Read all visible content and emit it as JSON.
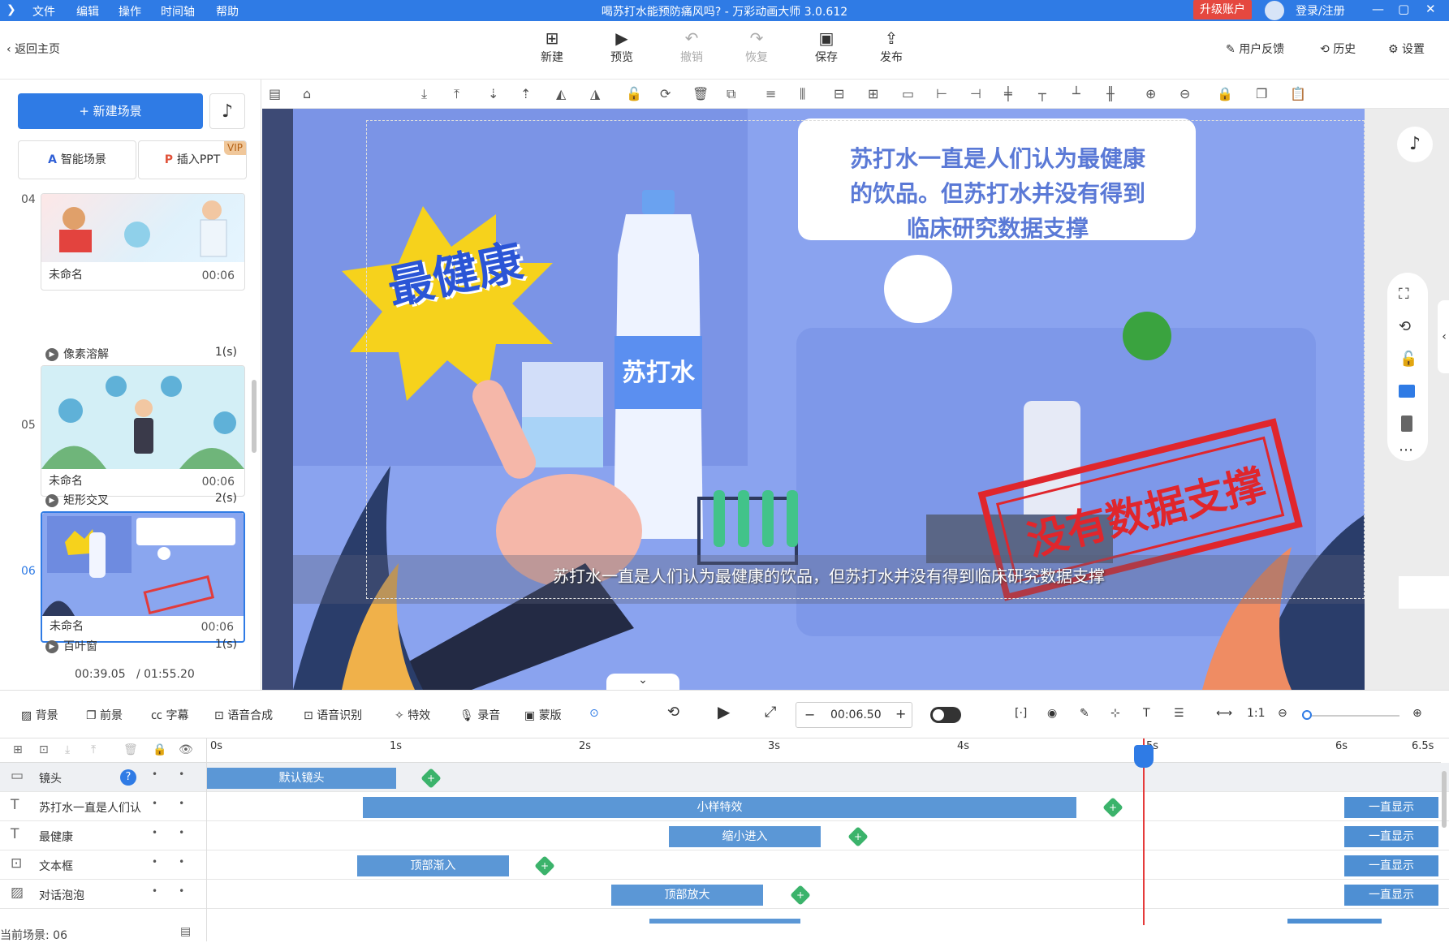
{
  "titlebar": {
    "menus": [
      "文件",
      "编辑",
      "操作",
      "时间轴",
      "帮助"
    ],
    "title": "喝苏打水能预防痛风吗? - 万彩动画大师 3.0.612",
    "upgrade": "升级账户",
    "login": "登录/注册"
  },
  "toolbar": {
    "back": "返回主页",
    "buttons": [
      {
        "label": "新建",
        "icon": "plus-square-icon"
      },
      {
        "label": "预览",
        "icon": "play-icon"
      },
      {
        "label": "撤销",
        "icon": "undo-icon"
      },
      {
        "label": "恢复",
        "icon": "redo-icon"
      },
      {
        "label": "保存",
        "icon": "save-icon"
      },
      {
        "label": "发布",
        "icon": "publish-icon"
      }
    ],
    "right": [
      "用户反馈",
      "历史",
      "设置"
    ]
  },
  "left": {
    "new_scene": "+ 新建场景",
    "smart_scene": "智能场景",
    "insert_ppt": "插入PPT",
    "vip": "VIP",
    "scenes": [
      {
        "num": "04",
        "name": "未命名",
        "duration": "00:06",
        "transition": "像素溶解",
        "trans_time": "1(s)"
      },
      {
        "num": "05",
        "name": "未命名",
        "duration": "00:06",
        "transition": "矩形交叉",
        "trans_time": "2(s)"
      },
      {
        "num": "06",
        "name": "未命名",
        "duration": "00:06",
        "transition": "百叶窗",
        "trans_time": "1(s)"
      }
    ],
    "time_current": "00:39.05",
    "time_total": "/ 01:55.20"
  },
  "canvas": {
    "camera_label": "默认镜头",
    "callout": "苏打水一直是人们认为最健康的饮品。但苏打水并没有得到临床研究数据支撑",
    "callout_lines": [
      "苏打水一直是人们认为最健康",
      "的饮品。但苏打水并没有得到",
      "临床研究数据支撑"
    ],
    "healthiest": "最健康",
    "bottle_label": "苏打水",
    "stamp": "没有数据支撑",
    "subtitle": "苏打水一直是人们认为最健康的饮品，但苏打水并没有得到临床研究数据支撑"
  },
  "tltool": {
    "items": [
      "背景",
      "前景",
      "字幕",
      "语音合成",
      "语音识别",
      "特效",
      "录音",
      "蒙版"
    ],
    "time": "00:06.50"
  },
  "timeline": {
    "ticks": [
      "0s",
      "1s",
      "2s",
      "3s",
      "4s",
      "5s",
      "6s",
      "6.5s"
    ],
    "rows": [
      {
        "label": "镜头",
        "icon": "camera-icon",
        "bar": "默认镜头"
      },
      {
        "label": "苏打水一直是人们认",
        "icon": "text-icon",
        "bar": "小样特效",
        "end": "一直显示"
      },
      {
        "label": "最健康",
        "icon": "text-icon",
        "bar": "缩小进入",
        "end": "一直显示"
      },
      {
        "label": "文本框",
        "icon": "textbox-icon",
        "bar": "顶部渐入",
        "end": "一直显示"
      },
      {
        "label": "对话泡泡",
        "icon": "image-icon",
        "bar": "顶部放大",
        "end": "一直显示"
      }
    ],
    "current_scene": "当前场景: 06"
  }
}
